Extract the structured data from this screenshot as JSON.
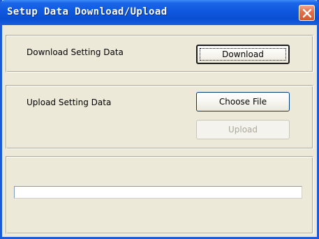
{
  "window": {
    "title": "Setup Data Download/Upload",
    "close_icon": "close-icon",
    "accent": "#0a4fd3",
    "close_color": "#d35a32"
  },
  "download_section": {
    "label": "Download Setting Data",
    "button_label": "Download"
  },
  "upload_section": {
    "label": "Upload Setting Data",
    "choose_button_label": "Choose File",
    "upload_button_label": "Upload",
    "upload_enabled": false
  },
  "progress": {
    "value_percent": 0
  }
}
